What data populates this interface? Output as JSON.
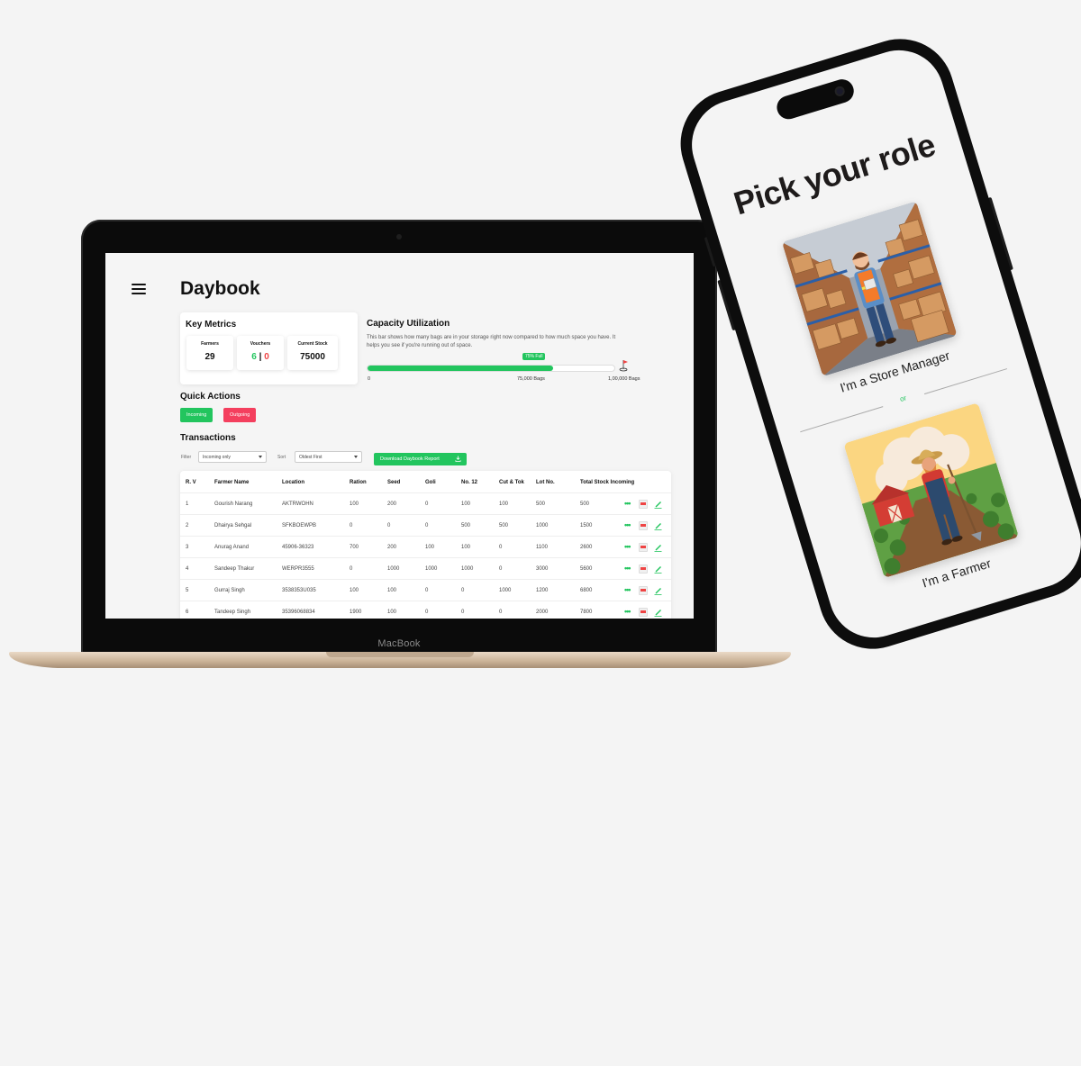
{
  "laptop": {
    "brand": "MacBook",
    "app": {
      "title": "Daybook",
      "key_metrics": {
        "title": "Key Metrics",
        "farmers": {
          "label": "Farmers",
          "value": "29"
        },
        "vouchers": {
          "label": "Vouchers",
          "incoming": "6",
          "separator": "|",
          "outgoing": "0"
        },
        "current_stock": {
          "label": "Current Stock",
          "value": "75000"
        }
      },
      "capacity": {
        "title": "Capacity Utilization",
        "description": "This bar shows how many bags are in your storage right now compared to how much space you have. It helps you see if you're running out of space.",
        "badge": "75% Full",
        "fill_fraction": 0.75,
        "tick_start": "0",
        "tick_current": "75,000 Bags",
        "tick_max": "1,00,000 Bags"
      },
      "quick_actions": {
        "title": "Quick Actions",
        "incoming_label": "Incoming",
        "outgoing_label": "Outgoing"
      },
      "transactions": {
        "title": "Transactions",
        "filter_label": "Filter",
        "filter_value": "Incoming only",
        "sort_label": "Sort",
        "sort_value": "Oldest First",
        "download_label": "Download Daybook Report",
        "columns": [
          "R. V",
          "Farmer Name",
          "Location",
          "Ration",
          "Seed",
          "Goli",
          "No. 12",
          "Cut & Tok",
          "Lot No.",
          "Total Stock Incoming"
        ],
        "rows": [
          [
            "1",
            "Gourish Narang",
            "AKTRWOHN",
            "100",
            "200",
            "0",
            "100",
            "100",
            "500",
            "500"
          ],
          [
            "2",
            "Dhairya Sehgal",
            "SFKBOEWPB",
            "0",
            "0",
            "0",
            "500",
            "500",
            "1000",
            "1500"
          ],
          [
            "3",
            "Anurag Anand",
            "45906-36323",
            "700",
            "200",
            "100",
            "100",
            "0",
            "1100",
            "2600"
          ],
          [
            "4",
            "Sandeep Thakur",
            "WERPR3555",
            "0",
            "1000",
            "1000",
            "1000",
            "0",
            "3000",
            "5600"
          ],
          [
            "5",
            "Gurraj Singh",
            "3538353U035",
            "100",
            "100",
            "0",
            "0",
            "1000",
            "1200",
            "6800"
          ],
          [
            "6",
            "Tandeep Singh",
            "35396068834",
            "1900",
            "100",
            "0",
            "0",
            "0",
            "2000",
            "7800"
          ]
        ]
      }
    }
  },
  "phone": {
    "title": "Pick your role",
    "store_manager_label": "I'm a Store Manager",
    "or_text": "or",
    "farmer_label": "I'm a Farmer"
  },
  "colors": {
    "accent_green": "#22c55e",
    "accent_red": "#f43f5e",
    "background": "#f4f4f4"
  }
}
